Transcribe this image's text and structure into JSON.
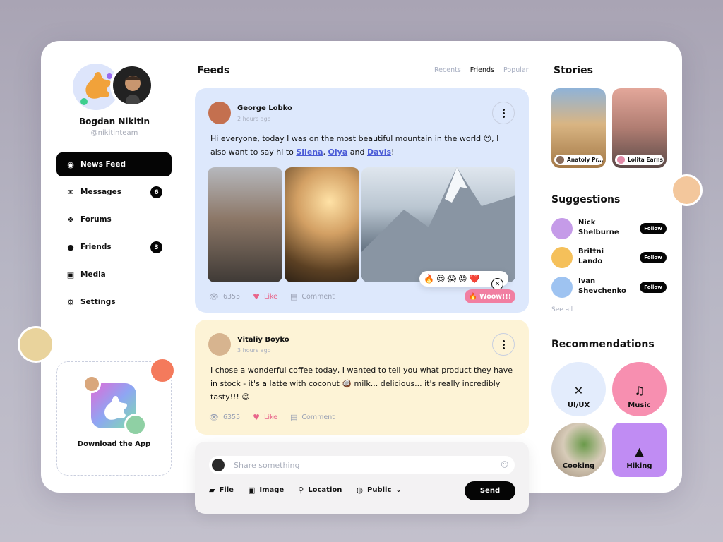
{
  "profile": {
    "name": "Bogdan Nikitin",
    "handle": "@nikitinteam"
  },
  "nav": [
    {
      "label": "News Feed",
      "icon": "compass-icon",
      "badge": null
    },
    {
      "label": "Messages",
      "icon": "envelope-icon",
      "badge": "6"
    },
    {
      "label": "Forums",
      "icon": "chat-bubbles-icon",
      "badge": null
    },
    {
      "label": "Friends",
      "icon": "people-icon",
      "badge": "3"
    },
    {
      "label": "Media",
      "icon": "image-icon",
      "badge": null
    },
    {
      "label": "Settings",
      "icon": "gear-icon",
      "badge": null
    }
  ],
  "download": {
    "label": "Download the App"
  },
  "feeds": {
    "title": "Feeds",
    "tabs": [
      "Recents",
      "Friends",
      "Popular"
    ],
    "active_tab": "Friends"
  },
  "posts": [
    {
      "author": "George Lobko",
      "time": "2 hours ago",
      "text_before": "Hi everyone, today I was on the most beautiful mountain in the world 😍, I also want to say hi to",
      "mentions": [
        "Silena",
        "Olya",
        "Davis"
      ],
      "conj": "and",
      "text_end": "!",
      "views": "6355",
      "like_label": "Like",
      "comment_label": "Comment",
      "reactions": [
        "🔥",
        "😍",
        "😱",
        "😡",
        "❤️"
      ],
      "reaction_selected": "🔥 Woow!!!"
    },
    {
      "author": "Vitaliy Boyko",
      "time": "3 hours ago",
      "text": "I chose a wonderful coffee today, I wanted to tell you what product they have in stock - it's a latte with coconut 🥥 milk... delicious... it's really incredibly tasty!!! 😊",
      "views": "6355",
      "like_label": "Like",
      "comment_label": "Comment"
    }
  ],
  "composer": {
    "placeholder": "Share something",
    "tools": [
      {
        "label": "File",
        "icon": "folder-icon"
      },
      {
        "label": "Image",
        "icon": "image-icon"
      },
      {
        "label": "Location",
        "icon": "pin-icon"
      },
      {
        "label": "Public",
        "icon": "globe-icon"
      }
    ],
    "send_label": "Send"
  },
  "stories": {
    "title": "Stories",
    "items": [
      {
        "name": "Anatoly Pr..."
      },
      {
        "name": "Lolita Earns"
      }
    ]
  },
  "suggestions": {
    "title": "Suggestions",
    "items": [
      {
        "name": "Nick Shelburne",
        "action": "Follow",
        "color": "#c59be8"
      },
      {
        "name": "Brittni Lando",
        "action": "Follow",
        "color": "#f5c05a"
      },
      {
        "name": "Ivan Shevchenko",
        "action": "Follow",
        "color": "#9ec3f1"
      }
    ],
    "see_all": "See all"
  },
  "recommendations": {
    "title": "Recommendations",
    "items": [
      {
        "label": "UI/UX",
        "icon": "tools-icon",
        "color": "#e3ecfc"
      },
      {
        "label": "Music",
        "icon": "music-notes-icon",
        "color": "#f78fb0"
      },
      {
        "label": "Cooking",
        "icon": "food-photo",
        "color": "#d7cbb8"
      },
      {
        "label": "Hiking",
        "icon": "mountain-icon",
        "color": "#c08cf3"
      }
    ]
  }
}
